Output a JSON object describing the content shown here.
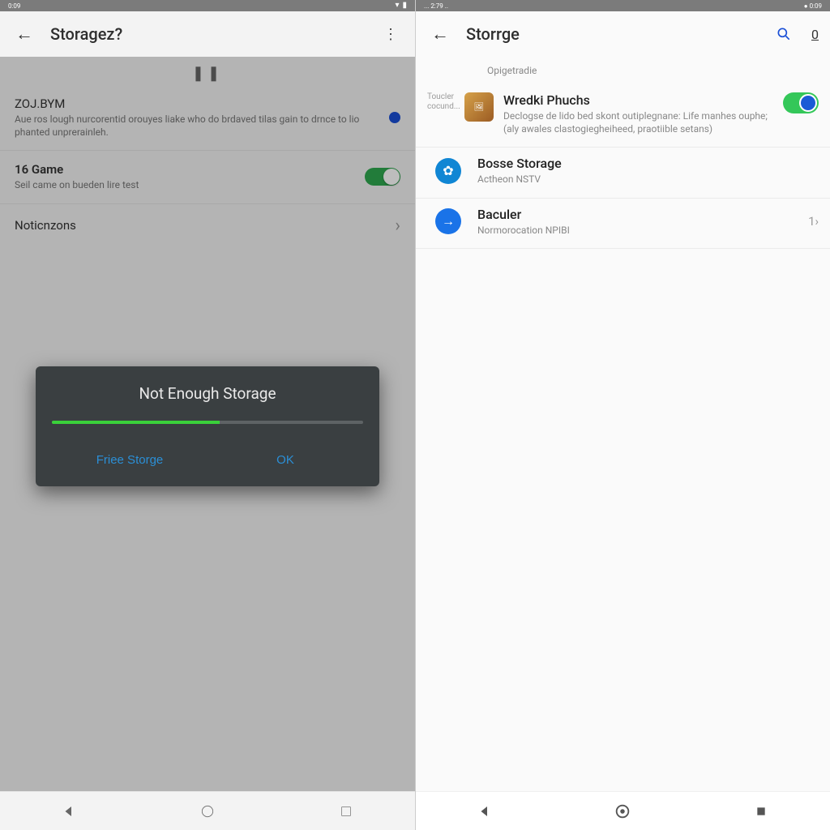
{
  "left": {
    "status": {
      "time": "0:09",
      "wifi": "wifi-icon",
      "battery": "battery-icon"
    },
    "header": {
      "title": "Storagez?",
      "menu_icon": "more-vert-icon"
    },
    "rows": [
      {
        "primary": "ZOJ.BYM",
        "secondary": "Aue ros lough nurcorentid orouyes liake who do brdaved tilas gain to drnce to lio phanted unprerainleh.",
        "kind": "radio",
        "checked": true
      },
      {
        "primary": "16 Game",
        "secondary": "Seil came on bueden lire test",
        "kind": "toggle",
        "checked": true
      },
      {
        "primary": "Noticnzons",
        "secondary": "",
        "kind": "chevron"
      }
    ],
    "dialog": {
      "title": "Not Enough Storage",
      "progress_pct": 54,
      "free_btn": "Friee Storge",
      "ok_btn": "OK"
    }
  },
  "right": {
    "status": {
      "left_text": "... 2:79 ..",
      "right_text": "● 0:09"
    },
    "header": {
      "title": "Storrge",
      "search_icon": "search-icon",
      "count": "0"
    },
    "section_label": "Opigetradie",
    "rows": [
      {
        "left_tiny": "Toucler cocund...",
        "primary": "Wredki Phuchs",
        "secondary": "Declogse de lido bed skont outiplegnane: Life manhes ouphe; (aly awales clastogiegheiheed, praotiible setans)",
        "icon": "photo-app",
        "tail": "toggle_on"
      },
      {
        "primary": "Bosse Storage",
        "secondary": "Actheon NSTV",
        "icon": "gear-badge",
        "tail": ""
      },
      {
        "primary": "Baculer",
        "secondary": "Normorocation NPIBI",
        "icon": "arrow-circle",
        "tail": "1›"
      }
    ]
  },
  "colors": {
    "accent_blue": "#1a73e8",
    "toggle_green": "#34c759",
    "dialog_bg": "#3a3f41",
    "action_blue": "#2b8fd6"
  }
}
